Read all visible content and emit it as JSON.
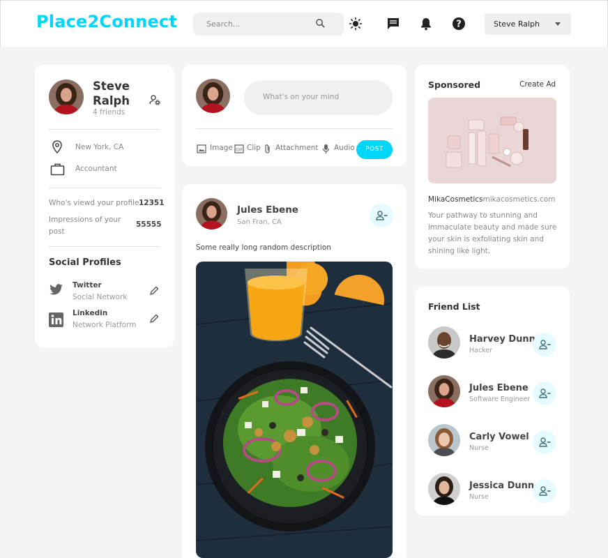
{
  "app": {
    "logo": "Place2Connect"
  },
  "nav": {
    "search_placeholder": "Search...",
    "user_name": "Steve Ralph"
  },
  "profile": {
    "name": "Steve Ralph",
    "friends": "4 friends",
    "location": "New York, CA",
    "occupation": "Accountant",
    "stats": [
      {
        "label": "Who's viewd your profile",
        "value": "12351"
      },
      {
        "label": "Impressions of your post",
        "value": "55555"
      }
    ],
    "social_title": "Social Profiles",
    "social": [
      {
        "name": "Twitter",
        "type": "Social Network"
      },
      {
        "name": "Linkedin",
        "type": "Network Platform"
      }
    ]
  },
  "composer": {
    "placeholder": "What's on your mind",
    "actions": [
      "Image",
      "Clip",
      "Attachment",
      "Audio"
    ],
    "post_label": "POST"
  },
  "feed_post": {
    "author": "Jules Ebene",
    "location": "San Fran, CA",
    "description": "Some really long random description"
  },
  "sponsored": {
    "title": "Sponsored",
    "create": "Create Ad",
    "brand": "MikaCosmetics",
    "url": "mikacosmetics.com",
    "text": "Your pathway to stunning and immaculate beauty and made sure your skin is exfoliating skin and shining like light."
  },
  "friends": {
    "title": "Friend List",
    "items": [
      {
        "name": "Harvey Dunn",
        "role": "Hacker"
      },
      {
        "name": "Jules Ebene",
        "role": "Software Engineer"
      },
      {
        "name": "Carly Vowel",
        "role": "Nurse"
      },
      {
        "name": "Jessica Dunn",
        "role": "Nurse"
      }
    ]
  },
  "colors": {
    "accent": "#00d5fa",
    "background": "#f4f4f4"
  }
}
